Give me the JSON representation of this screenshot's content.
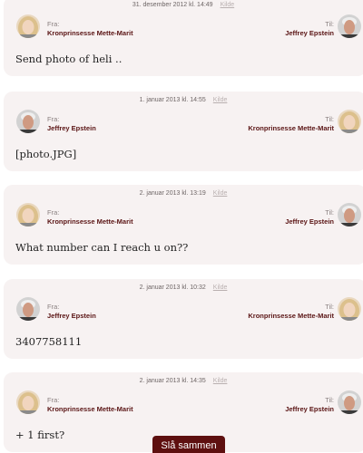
{
  "source_label": "Kilde",
  "from_label": "Fra:",
  "to_label": "Til:",
  "messages": [
    {
      "timestamp": "31. desember 2012 kl. 14:49",
      "from": "Kronprinsesse Mette-Marit",
      "to": "Jeffrey Epstein",
      "text": "Send photo of heli .."
    },
    {
      "timestamp": "1. januar 2013 kl. 14:55",
      "from": "Jeffrey Epstein",
      "to": "Kronprinsesse Mette-Marit",
      "text": "[photo.JPG]"
    },
    {
      "timestamp": "2. januar 2013 kl. 13:19",
      "from": "Kronprinsesse Mette-Marit",
      "to": "Jeffrey Epstein",
      "text": "What number can I reach u on??"
    },
    {
      "timestamp": "2. januar 2013 kl. 10:32",
      "from": "Jeffrey Epstein",
      "to": "Kronprinsesse Mette-Marit",
      "text": "3407758111"
    },
    {
      "timestamp": "2. januar 2013 kl. 14:35",
      "from": "Kronprinsesse Mette-Marit",
      "to": "Jeffrey Epstein",
      "text": "+ 1 first?"
    }
  ],
  "merge_button_label": "Slå sammen",
  "colors": {
    "accent": "#5e1010",
    "name_text": "#5a1414",
    "card_bg": "#f7f2f2"
  }
}
